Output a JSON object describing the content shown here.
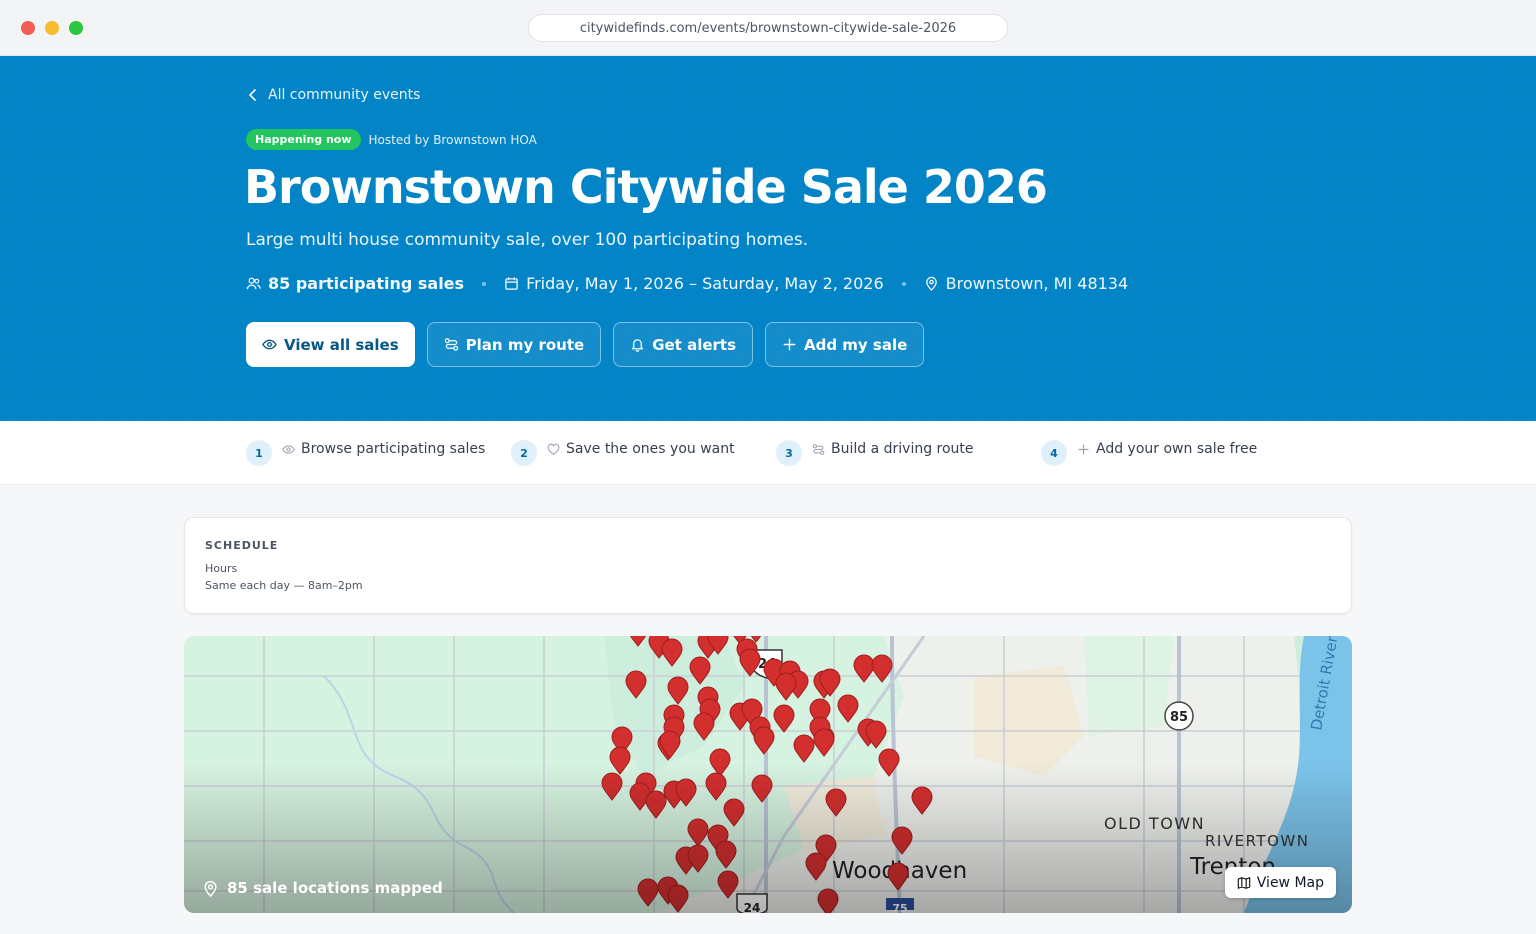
{
  "browser": {
    "url": "citywidefinds.com/events/brownstown-citywide-sale-2026"
  },
  "hero": {
    "back_link": "All community events",
    "status_badge": "Happening now",
    "host": "Hosted by Brownstown HOA",
    "title": "Brownstown Citywide Sale 2026",
    "subtitle": "Large multi house community sale, over 100 participating homes.",
    "participants": "85 participating sales",
    "dates": "Friday, May 1, 2026 – Saturday, May 2, 2026",
    "location": "Brownstown, MI 48134",
    "buttons": {
      "view_all": "View all sales",
      "plan_route": "Plan my route",
      "get_alerts": "Get alerts",
      "add_sale": "Add my sale"
    },
    "colors": {
      "hero_bg": "#0284c7",
      "badge": "#22c55e"
    }
  },
  "steps": [
    {
      "num": "1",
      "icon": "eye-icon",
      "label": "Browse participating sales"
    },
    {
      "num": "2",
      "icon": "heart-icon",
      "label": "Save the ones you want"
    },
    {
      "num": "3",
      "icon": "route-icon",
      "label": "Build a driving route"
    },
    {
      "num": "4",
      "icon": "plus-icon",
      "label": "Add your own sale free"
    }
  ],
  "schedule": {
    "heading": "SCHEDULE",
    "label": "Hours",
    "value": "Same each day — 8am–2pm"
  },
  "map": {
    "caption": "85 sale locations mapped",
    "view_button": "View Map",
    "labels": {
      "old_town": "OLD TOWN",
      "rivertown": "RIVERTOWN",
      "woodhaven": "Woodhaven",
      "trenton": "Trenton",
      "detroit_river": "Detroit River",
      "route_24": "24",
      "route_85": "85",
      "route_75": "75"
    },
    "pin_color": "#d32f2f"
  }
}
